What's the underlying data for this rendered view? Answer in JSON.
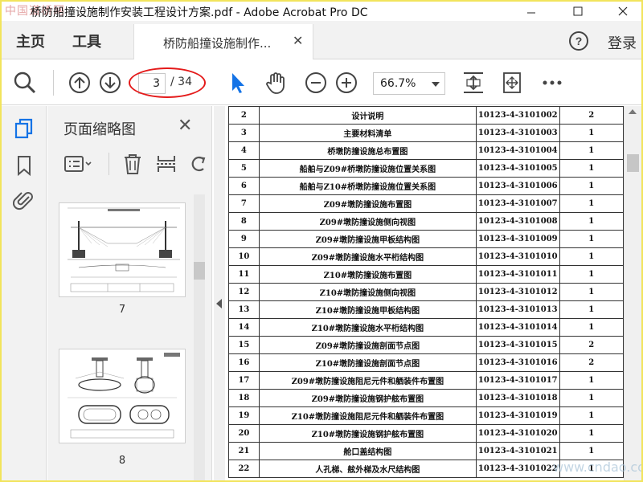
{
  "window": {
    "title": "桥防船撞设施制作安装工程设计方案.pdf - Adobe Acrobat Pro DC",
    "watermark_left": "中国道桥网",
    "watermark_right": "www.cndao.com"
  },
  "tabs": {
    "home": "主页",
    "tools": "工具",
    "document": "桥防船撞设施制作...",
    "login": "登录"
  },
  "toolbar": {
    "current_page": "3",
    "total_pages": "/ 34",
    "zoom": "66.7%"
  },
  "thumbnail_panel": {
    "title": "页面缩略图",
    "thumbnails": [
      {
        "page_label": "7"
      },
      {
        "page_label": "8"
      }
    ]
  },
  "document_table": {
    "rows": [
      {
        "no": "2",
        "name": "设计说明",
        "code": "10123-4-3101002",
        "qty": "2"
      },
      {
        "no": "3",
        "name": "主要材料清单",
        "code": "10123-4-3101003",
        "qty": "1"
      },
      {
        "no": "4",
        "name": "桥墩防撞设施总布置图",
        "code": "10123-4-3101004",
        "qty": "1"
      },
      {
        "no": "5",
        "name": "船舶与Z09#桥墩防撞设施位置关系图",
        "code": "10123-4-3101005",
        "qty": "1"
      },
      {
        "no": "6",
        "name": "船舶与Z10#桥墩防撞设施位置关系图",
        "code": "10123-4-3101006",
        "qty": "1"
      },
      {
        "no": "7",
        "name": "Z09#墩防撞设施布置图",
        "code": "10123-4-3101007",
        "qty": "1"
      },
      {
        "no": "8",
        "name": "Z09#墩防撞设施侧向视图",
        "code": "10123-4-3101008",
        "qty": "1"
      },
      {
        "no": "9",
        "name": "Z09#墩防撞设施甲板结构图",
        "code": "10123-4-3101009",
        "qty": "1"
      },
      {
        "no": "10",
        "name": "Z09#墩防撞设施水平桁结构图",
        "code": "10123-4-3101010",
        "qty": "1"
      },
      {
        "no": "11",
        "name": "Z10#墩防撞设施布置图",
        "code": "10123-4-3101011",
        "qty": "1"
      },
      {
        "no": "12",
        "name": "Z10#墩防撞设施侧向视图",
        "code": "10123-4-3101012",
        "qty": "1"
      },
      {
        "no": "13",
        "name": "Z10#墩防撞设施甲板结构图",
        "code": "10123-4-3101013",
        "qty": "1"
      },
      {
        "no": "14",
        "name": "Z10#墩防撞设施水平桁结构图",
        "code": "10123-4-3101014",
        "qty": "1"
      },
      {
        "no": "15",
        "name": "Z09#墩防撞设施剖面节点图",
        "code": "10123-4-3101015",
        "qty": "2"
      },
      {
        "no": "16",
        "name": "Z10#墩防撞设施剖面节点图",
        "code": "10123-4-3101016",
        "qty": "2"
      },
      {
        "no": "17",
        "name": "Z09#墩防撞设施阻尼元件和舾装件布置图",
        "code": "10123-4-3101017",
        "qty": "1"
      },
      {
        "no": "18",
        "name": "Z09#墩防撞设施钢护舷布置图",
        "code": "10123-4-3101018",
        "qty": "1"
      },
      {
        "no": "19",
        "name": "Z10#墩防撞设施阻尼元件和舾装件布置图",
        "code": "10123-4-3101019",
        "qty": "1"
      },
      {
        "no": "20",
        "name": "Z10#墩防撞设施钢护舷布置图",
        "code": "10123-4-3101020",
        "qty": "1"
      },
      {
        "no": "21",
        "name": "舱口盖结构图",
        "code": "10123-4-3101021",
        "qty": "1"
      },
      {
        "no": "22",
        "name": "人孔梯、舷外梯及水尺结构图",
        "code": "10123-4-3101022",
        "qty": "1"
      }
    ]
  },
  "colors": {
    "accent_blue": "#1473e6",
    "annotation_red": "#e41a1a",
    "frame_yellow": "#f2e45c"
  }
}
